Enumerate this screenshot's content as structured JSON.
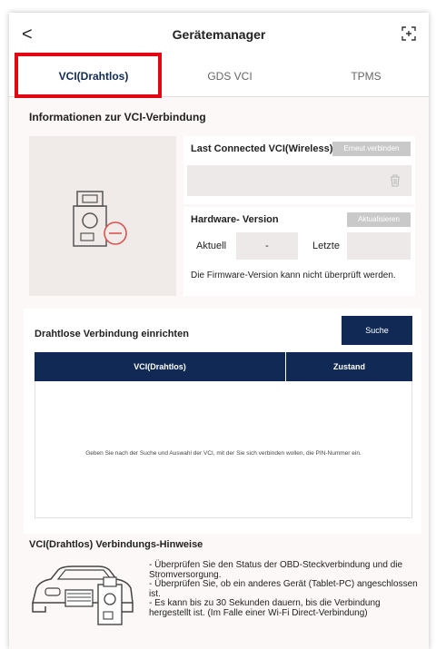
{
  "header": {
    "back_glyph": "<",
    "title": "Gerätemanager",
    "expand_icon": "expand-icon"
  },
  "tabs": [
    {
      "label": "VCI(Drahtlos)",
      "active": true
    },
    {
      "label": "GDS VCI",
      "active": false
    },
    {
      "label": "TPMS",
      "active": false
    }
  ],
  "info": {
    "title": "Informationen zur VCI-Verbindung",
    "last_connected_label": "Last Connected VCI(Wireless)",
    "reconnect_button": "Erneut verbinden",
    "last_connected_value": "",
    "hardware_label": "Hardware- Version",
    "update_button": "Aktualisieren",
    "current_label": "Aktuell",
    "current_value": "-",
    "latest_label": "Letzte",
    "latest_value": "",
    "firmware_note": "Die Firmware-Version kann nicht überprüft werden."
  },
  "wireless": {
    "title": "Drahtlose Verbindung einrichten",
    "search_button": "Suche",
    "columns": [
      "VCI(Drahtlos)",
      "Zustand"
    ],
    "empty_text": "Geben Sie nach der Suche und Auswahl der VCI, mit der Sie sich verbinden wollen, die PIN-Nummer ein."
  },
  "hints": {
    "title": "VCI(Drahtlos) Verbindungs-Hinweise",
    "items": [
      "- Überprüfen Sie den Status der OBD-Steckverbindung und die Stromversorgung.",
      "- Überprüfen Sie, ob ein anderes Gerät (Tablet-PC) angeschlossen ist.",
      "- Es kann bis zu 30 Sekunden dauern, bis die Verbindung hergestellt ist. (Im Falle einer Wi-Fi Direct-Verbindung)"
    ]
  },
  "colors": {
    "navy": "#112a55",
    "highlight": "#e30613",
    "disabled": "#c9c9c9"
  }
}
